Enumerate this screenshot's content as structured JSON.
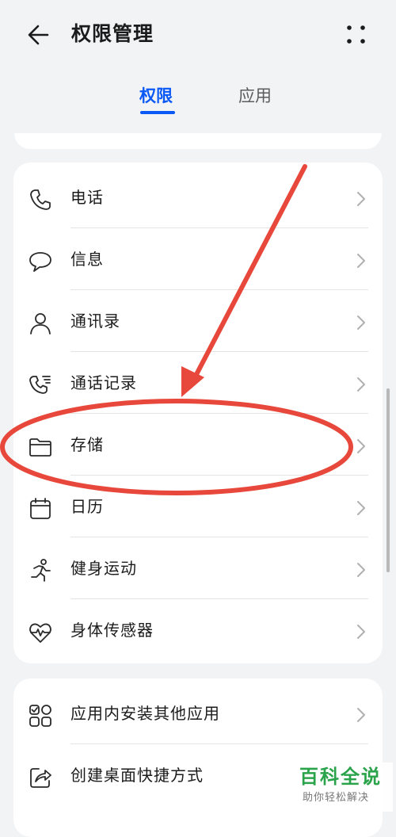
{
  "header": {
    "title": "权限管理",
    "back_icon": "arrow-left-icon",
    "more_icon": "more-dots-icon"
  },
  "tabs": [
    {
      "label": "权限",
      "active": true
    },
    {
      "label": "应用",
      "active": false
    }
  ],
  "permissions": [
    {
      "label": "电话",
      "icon": "phone-icon"
    },
    {
      "label": "信息",
      "icon": "message-bubble-icon"
    },
    {
      "label": "通讯录",
      "icon": "contacts-icon"
    },
    {
      "label": "通话记录",
      "icon": "call-log-icon"
    },
    {
      "label": "存储",
      "icon": "folder-icon"
    },
    {
      "label": "日历",
      "icon": "calendar-icon"
    },
    {
      "label": "健身运动",
      "icon": "running-icon"
    },
    {
      "label": "身体传感器",
      "icon": "heart-pulse-icon"
    }
  ],
  "special_permissions": [
    {
      "label": "应用内安装其他应用",
      "icon": "app-grid-icon"
    },
    {
      "label": "创建桌面快捷方式",
      "icon": "shortcut-share-icon"
    }
  ],
  "annotation": {
    "highlight_target": "存储",
    "color": "#e8483b"
  },
  "watermark": {
    "title": "百科全说",
    "subtitle": "助你轻松解决"
  },
  "colors": {
    "accent": "#0a59f7",
    "background": "#f1f3f5",
    "card": "#ffffff"
  }
}
